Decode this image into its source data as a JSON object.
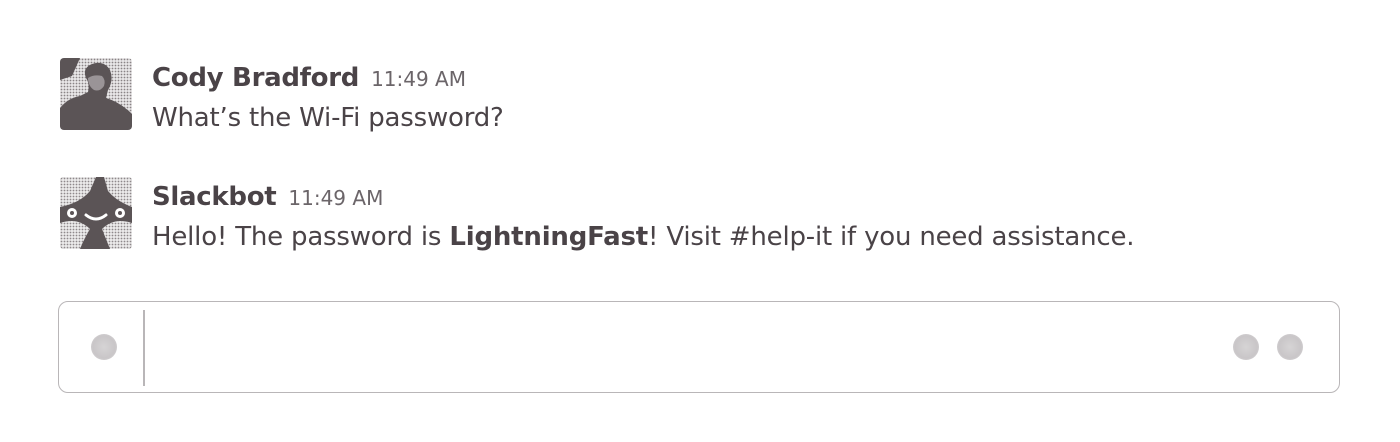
{
  "messages": [
    {
      "sender": "Cody Bradford",
      "time": "11:49 AM",
      "text": "What’s the Wi-Fi password?",
      "avatar_icon": "user-photo"
    },
    {
      "sender": "Slackbot",
      "time": "11:49 AM",
      "text_before": "Hello! The password is ",
      "text_bold": "LightningFast",
      "text_after": "! Visit #help-it if you need assistance.",
      "avatar_icon": "slackbot-face"
    }
  ],
  "composer": {
    "value": "",
    "placeholder": "",
    "left_icon": "attach-icon",
    "right_icons": [
      "mention-icon",
      "emoji-icon"
    ]
  },
  "colors": {
    "text": "#4a4347",
    "timestamp": "#6b6569",
    "border": "#b9b6b8",
    "avatar_dark": "#5b5456"
  }
}
